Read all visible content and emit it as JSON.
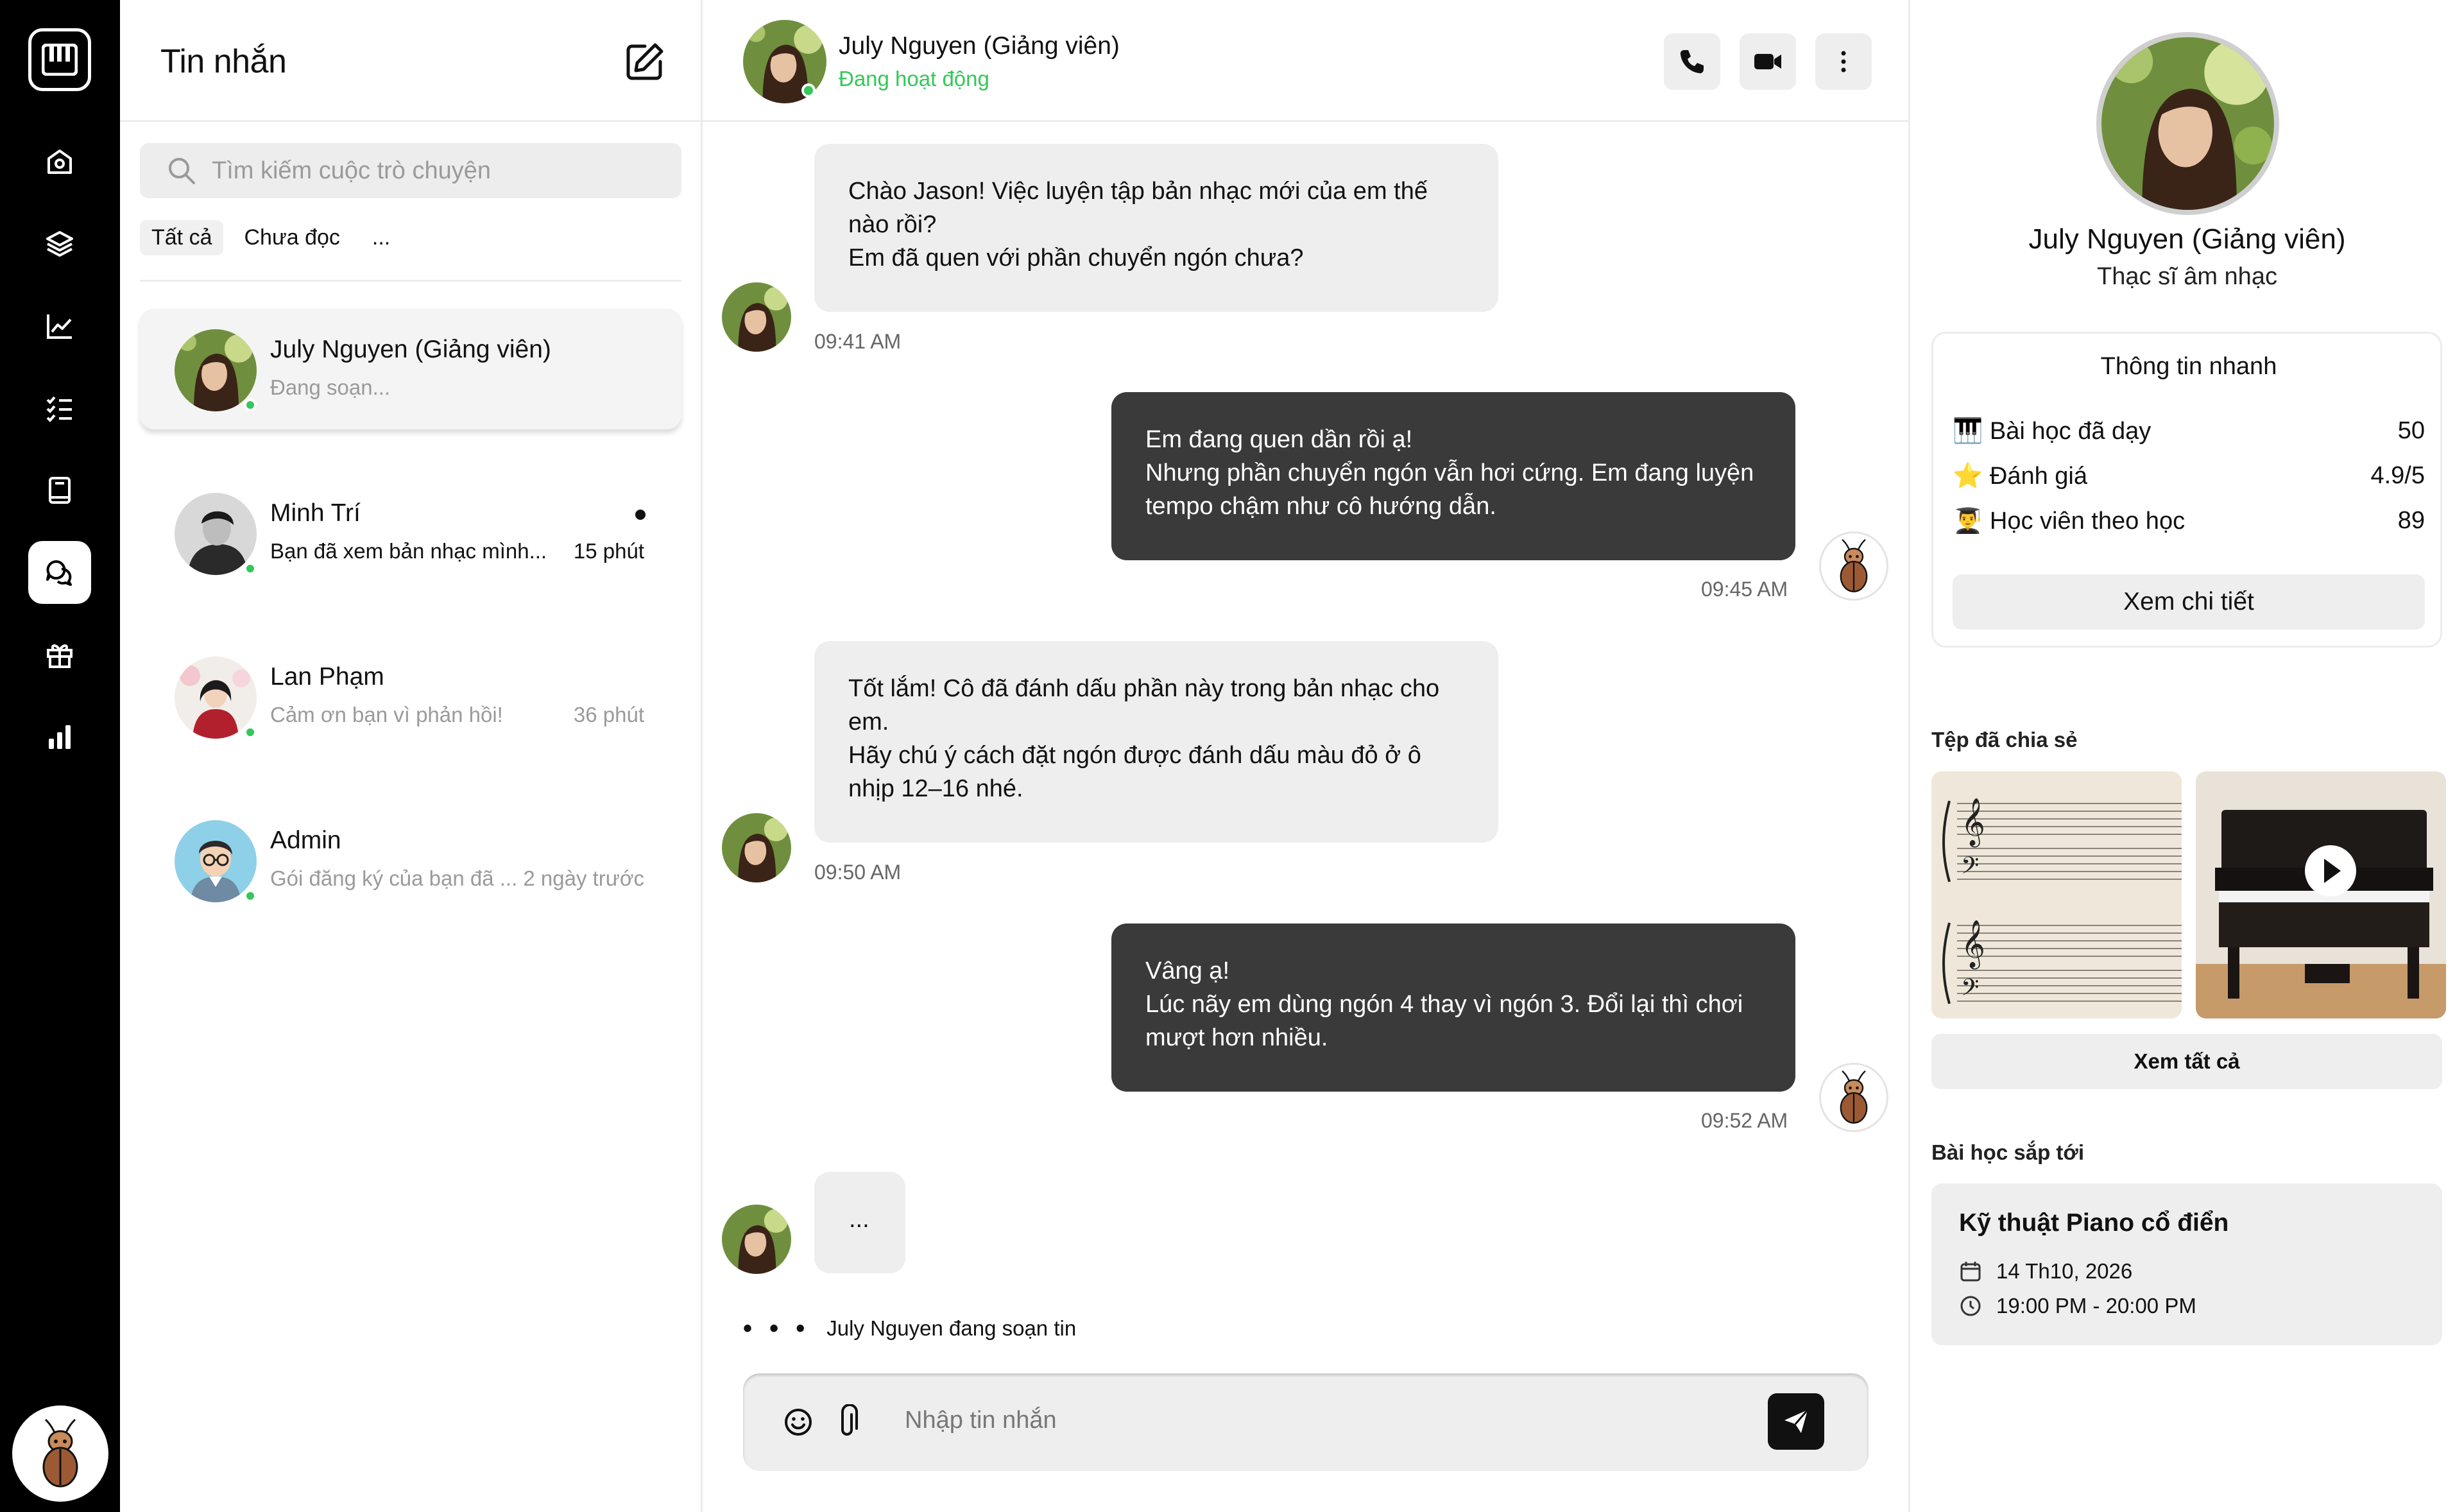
{
  "sidebar": {
    "logo_icon": "piano-keys-icon",
    "nav": [
      "home-icon",
      "layers-icon",
      "chart-line-icon",
      "checklist-icon",
      "book-icon",
      "chat-icon",
      "gift-icon",
      "bar-chart-icon"
    ],
    "active": "chat-icon",
    "profile_icon": "beetle-avatar"
  },
  "conversations": {
    "title": "Tin nhắn",
    "search_placeholder": "Tìm kiếm cuộc trò chuyện",
    "filters": [
      "Tất cả",
      "Chưa đọc",
      "..."
    ],
    "items": [
      {
        "name": "July Nguyen (Giảng viên)",
        "preview": "Đang soạn...",
        "time": "",
        "online": true,
        "active": true
      },
      {
        "name": "Minh Trí",
        "preview": "Bạn đã xem bản nhạc mình...",
        "time": "15 phút",
        "online": true,
        "unread": true
      },
      {
        "name": "Lan Phạm",
        "preview": "Cảm ơn bạn vì phản hồi!",
        "time": "36 phút",
        "online": true
      },
      {
        "name": "Admin",
        "preview": "Gói đăng ký của bạn đã ...",
        "time": "2 ngày trước",
        "online": true
      }
    ]
  },
  "chat": {
    "name": "July Nguyen (Giảng viên)",
    "status": "Đang hoạt động",
    "messages": [
      {
        "from": "in",
        "text": "Chào Jason! Việc luyện tập bản nhạc mới của em thế nào rồi?\nEm đã quen với phần chuyển ngón chưa?",
        "time": "09:41 AM"
      },
      {
        "from": "out",
        "text": "Em đang quen dần rồi ạ!\nNhưng phần chuyển ngón vẫn hơi cứng. Em đang luyện tempo chậm như cô hướng dẫn.",
        "time": "09:45 AM"
      },
      {
        "from": "in",
        "text": "Tốt lắm! Cô đã đánh dấu phần này trong bản nhạc cho em.\nHãy chú ý cách đặt ngón được đánh dấu màu đỏ ở ô nhịp 12–16 nhé.",
        "time": "09:50 AM"
      },
      {
        "from": "out",
        "text": "Vâng ạ!\nLúc nãy em dùng ngón 4 thay vì ngón 3. Đổi lại thì chơi mượt hơn nhiều.",
        "time": "09:52 AM"
      },
      {
        "from": "in",
        "text": "...",
        "time": ""
      }
    ],
    "typing_dots": "• • •",
    "typing_text": "July Nguyen đang soạn tin",
    "input_placeholder": "Nhập tin nhắn"
  },
  "profile": {
    "name": "July Nguyen (Giảng viên)",
    "role": "Thạc sĩ âm nhạc",
    "quick_title": "Thông tin nhanh",
    "stats": [
      {
        "icon": "🎹",
        "label": "Bài học đã dạy",
        "value": "50"
      },
      {
        "icon": "⭐",
        "label": "Đánh giá",
        "value": "4.9/5"
      },
      {
        "icon": "👨‍🎓",
        "label": "Học viên theo học",
        "value": "89"
      }
    ],
    "detail_button": "Xem chi tiết",
    "files_title": "Tệp đã chia sẻ",
    "files_button": "Xem tất cả",
    "upcoming_title": "Bài học sắp tới",
    "lesson": {
      "title": "Kỹ thuật Piano cổ điển",
      "date": "14 Th10, 2026",
      "time": "19:00 PM - 20:00 PM"
    }
  }
}
